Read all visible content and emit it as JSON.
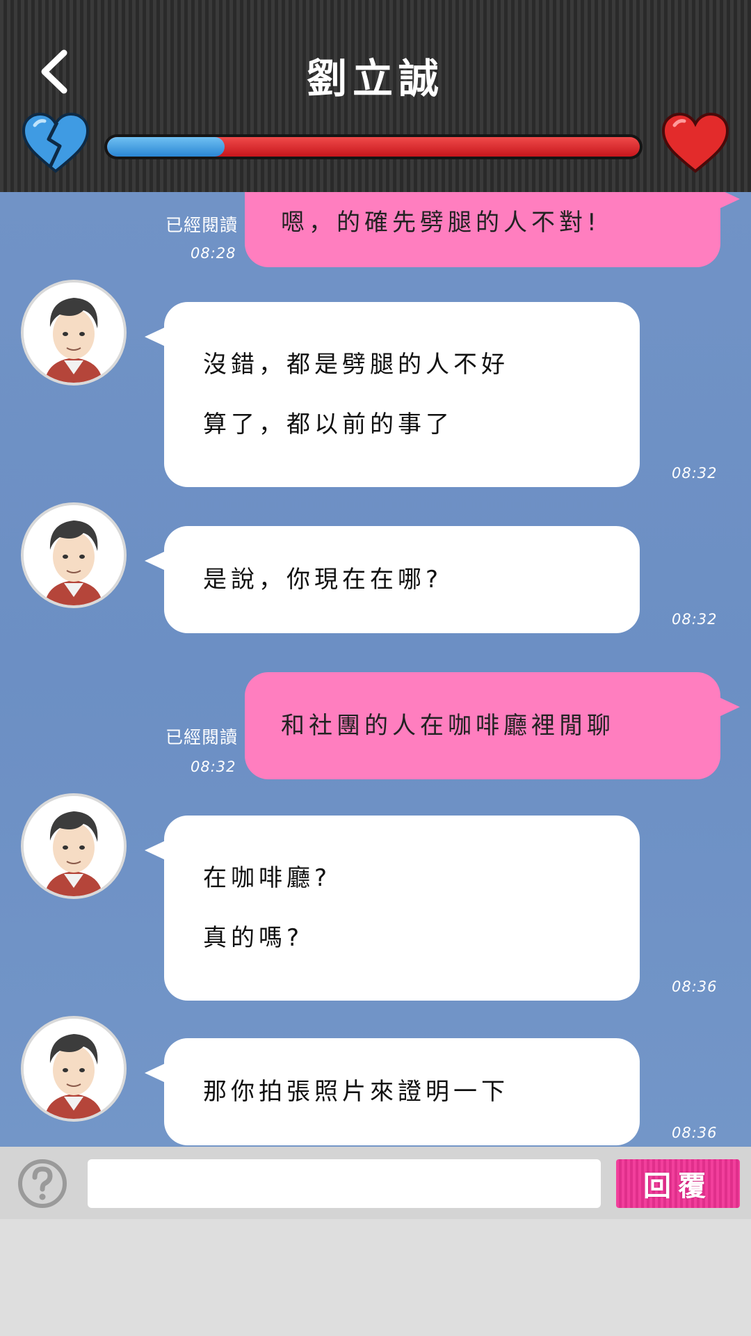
{
  "header": {
    "title": "劉立誠",
    "affection_level": 0.22,
    "colors": {
      "meter_good": "#3a98e0",
      "meter_bad": "#d9232a"
    },
    "icons": {
      "back": "chevron-left-icon",
      "left": "broken-heart-icon",
      "right": "heart-icon"
    }
  },
  "messages": [
    {
      "side": "out",
      "read": "已經閱讀",
      "time": "08:28",
      "lines": [
        "嗯，的確先劈腿的人不對!"
      ]
    },
    {
      "side": "in",
      "time": "08:32",
      "lines": [
        "沒錯，都是劈腿的人不好",
        "算了，都以前的事了"
      ]
    },
    {
      "side": "in",
      "time": "08:32",
      "lines": [
        "是說，你現在在哪?"
      ]
    },
    {
      "side": "out",
      "read": "已經閱讀",
      "time": "08:32",
      "lines": [
        "和社團的人在咖啡廳裡閒聊"
      ]
    },
    {
      "side": "in",
      "time": "08:36",
      "lines": [
        "在咖啡廳?",
        "真的嗎?"
      ]
    },
    {
      "side": "in",
      "time": "08:36",
      "lines": [
        "那你拍張照片來證明一下"
      ]
    }
  ],
  "input": {
    "value": "",
    "placeholder": ""
  },
  "reply_button": {
    "label": "回覆"
  },
  "colors": {
    "chat_bg": "#6f92c5",
    "out_bubble": "#ff7ebf",
    "in_bubble": "#ffffff"
  }
}
